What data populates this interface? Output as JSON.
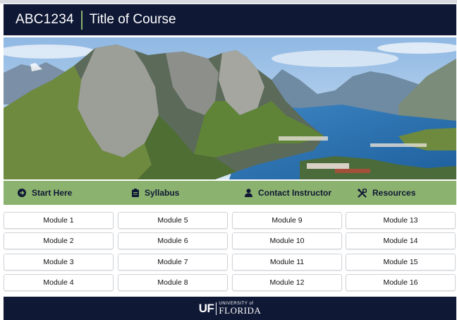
{
  "header": {
    "course_code": "ABC1234",
    "course_title": "Title of Course"
  },
  "nav": {
    "items": [
      {
        "label": "Start Here",
        "icon": "arrow-circle-right-icon"
      },
      {
        "label": "Syllabus",
        "icon": "clipboard-icon"
      },
      {
        "label": "Contact Instructor",
        "icon": "user-icon"
      },
      {
        "label": "Resources",
        "icon": "tools-icon"
      }
    ]
  },
  "modules": {
    "columns": [
      [
        "Module 1",
        "Module 2",
        "Module 3",
        "Module 4"
      ],
      [
        "Module 5",
        "Module 6",
        "Module 7",
        "Module 8"
      ],
      [
        "Module 9",
        "Module 10",
        "Module 11",
        "Module 12"
      ],
      [
        "Module 13",
        "Module 14",
        "Module 15",
        "Module 16"
      ]
    ]
  },
  "footer": {
    "logo_mark": "UF",
    "logo_small": "UNIVERSITY of",
    "logo_big": "FLORIDA"
  },
  "colors": {
    "navy": "#0f1835",
    "green": "#8bb26e"
  }
}
